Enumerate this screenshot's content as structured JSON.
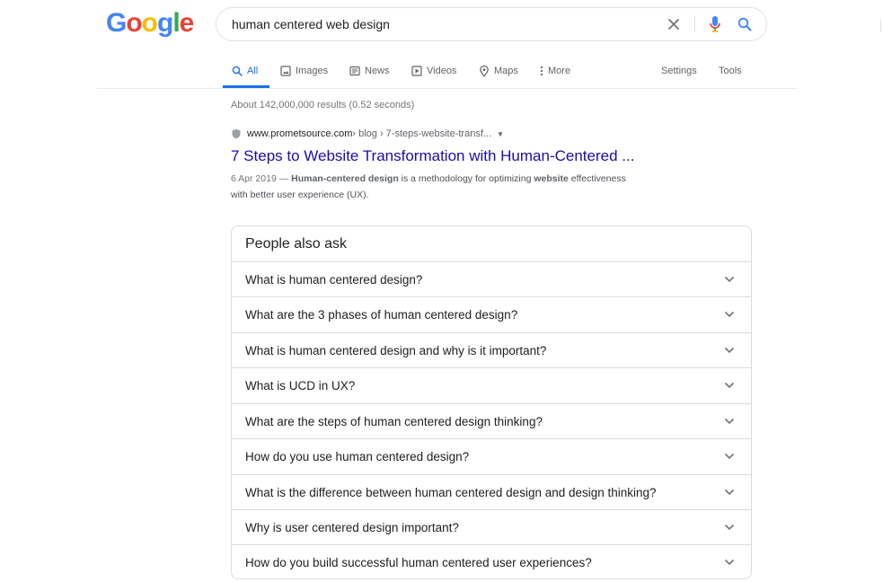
{
  "logo": {
    "letters": [
      "G",
      "o",
      "o",
      "g",
      "l",
      "e"
    ],
    "colors": [
      "#4285F4",
      "#EA4335",
      "#FBBC05",
      "#4285F4",
      "#34A853",
      "#EA4335"
    ]
  },
  "search": {
    "query": "human centered web design"
  },
  "tabs": [
    {
      "label": "All",
      "icon": "search-icon",
      "active": true
    },
    {
      "label": "Images",
      "icon": "image-icon",
      "active": false
    },
    {
      "label": "News",
      "icon": "newspaper-icon",
      "active": false
    },
    {
      "label": "Videos",
      "icon": "play-icon",
      "active": false
    },
    {
      "label": "Maps",
      "icon": "map-pin-icon",
      "active": false
    },
    {
      "label": "More",
      "icon": "more-vert-icon",
      "active": false
    }
  ],
  "tools": {
    "settings_label": "Settings",
    "tools_label": "Tools"
  },
  "stats": "About 142,000,000 results (0.52 seconds)",
  "result": {
    "domain": "www.prometsource.com",
    "path": " › blog › 7-steps-website-transf...",
    "title": "7 Steps to Website Transformation with Human-Centered ...",
    "date": "6 Apr 2019 — ",
    "snippet_b1": "Human-centered design",
    "snippet_t1": " is a methodology for optimizing ",
    "snippet_b2": "website",
    "snippet_t2": " effectiveness",
    "snippet_t3": "with better user experience (UX)."
  },
  "paa": {
    "title": "People also ask",
    "questions": [
      "What is human centered design?",
      "What are the 3 phases of human centered design?",
      "What is human centered design and why is it important?",
      "What is UCD in UX?",
      "What are the steps of human centered design thinking?",
      "How do you use human centered design?",
      "What is the difference between human centered design and design thinking?",
      "Why is user centered design important?",
      "How do you build successful human centered user experiences?"
    ]
  },
  "colors": {
    "accent": "#1a73e8",
    "link": "#1a0dab",
    "text": "#202124",
    "muted": "#70757a"
  }
}
